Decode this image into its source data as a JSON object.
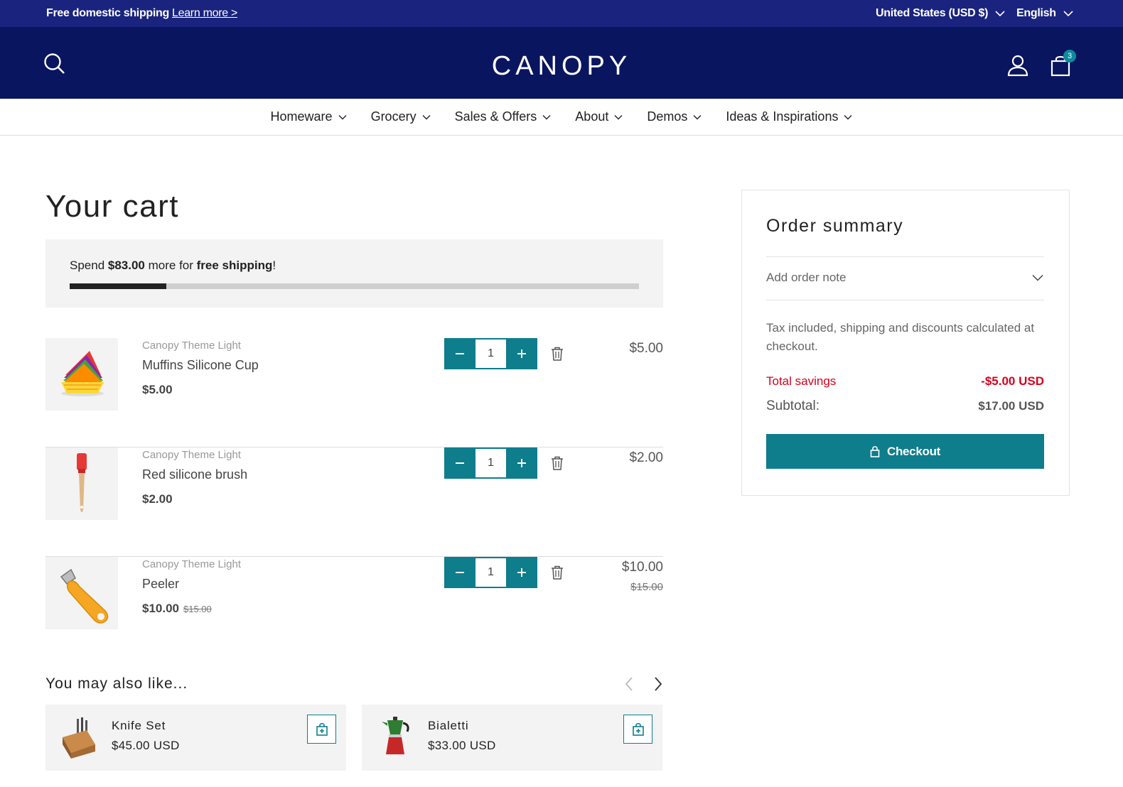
{
  "announcement": {
    "text": "Free domestic shipping",
    "link": "Learn more >",
    "country": "United States (USD $)",
    "language": "English"
  },
  "header": {
    "logo": "CANOPY",
    "cart_count": "3",
    "icons": [
      "search-icon",
      "account-icon",
      "cart-icon"
    ]
  },
  "nav": {
    "items": [
      {
        "label": "Homeware"
      },
      {
        "label": "Grocery"
      },
      {
        "label": "Sales & Offers"
      },
      {
        "label": "About"
      },
      {
        "label": "Demos"
      },
      {
        "label": "Ideas & Inspirations"
      }
    ]
  },
  "cart": {
    "title": "Your cart",
    "shipping": {
      "prefix": "Spend ",
      "amount": "$83.00",
      "middle": " more for ",
      "bold": "free shipping",
      "suffix": "!",
      "progress": 0.17
    },
    "items": [
      {
        "vendor": "Canopy Theme Light",
        "name": "Muffins Silicone Cup",
        "price": "$5.00",
        "was": "",
        "qty": "1",
        "total": "$5.00",
        "total_was": ""
      },
      {
        "vendor": "Canopy Theme Light",
        "name": "Red silicone brush",
        "price": "$2.00",
        "was": "",
        "qty": "1",
        "total": "$2.00",
        "total_was": ""
      },
      {
        "vendor": "Canopy Theme Light",
        "name": "Peeler",
        "price": "$10.00",
        "was": "$15.00",
        "qty": "1",
        "total": "$10.00",
        "total_was": "$15.00"
      }
    ]
  },
  "recommendations": {
    "title": "You may also like...",
    "items": [
      {
        "name": "Knife Set",
        "price": "$45.00 USD"
      },
      {
        "name": "Bialetti",
        "price": "$33.00 USD"
      }
    ]
  },
  "summary": {
    "title": "Order summary",
    "note": "Add order note",
    "tax": "Tax included, shipping and discounts calculated at checkout.",
    "savings_label": "Total savings",
    "savings_value": "-$5.00 USD",
    "subtotal_label": "Subtotal:",
    "subtotal_value": "$17.00 USD",
    "checkout": "Checkout"
  },
  "colors": {
    "announcement_bg": "#1a237e",
    "header_bg": "#0a1560",
    "accent": "#0e7d8c",
    "savings": "#d6001c"
  }
}
